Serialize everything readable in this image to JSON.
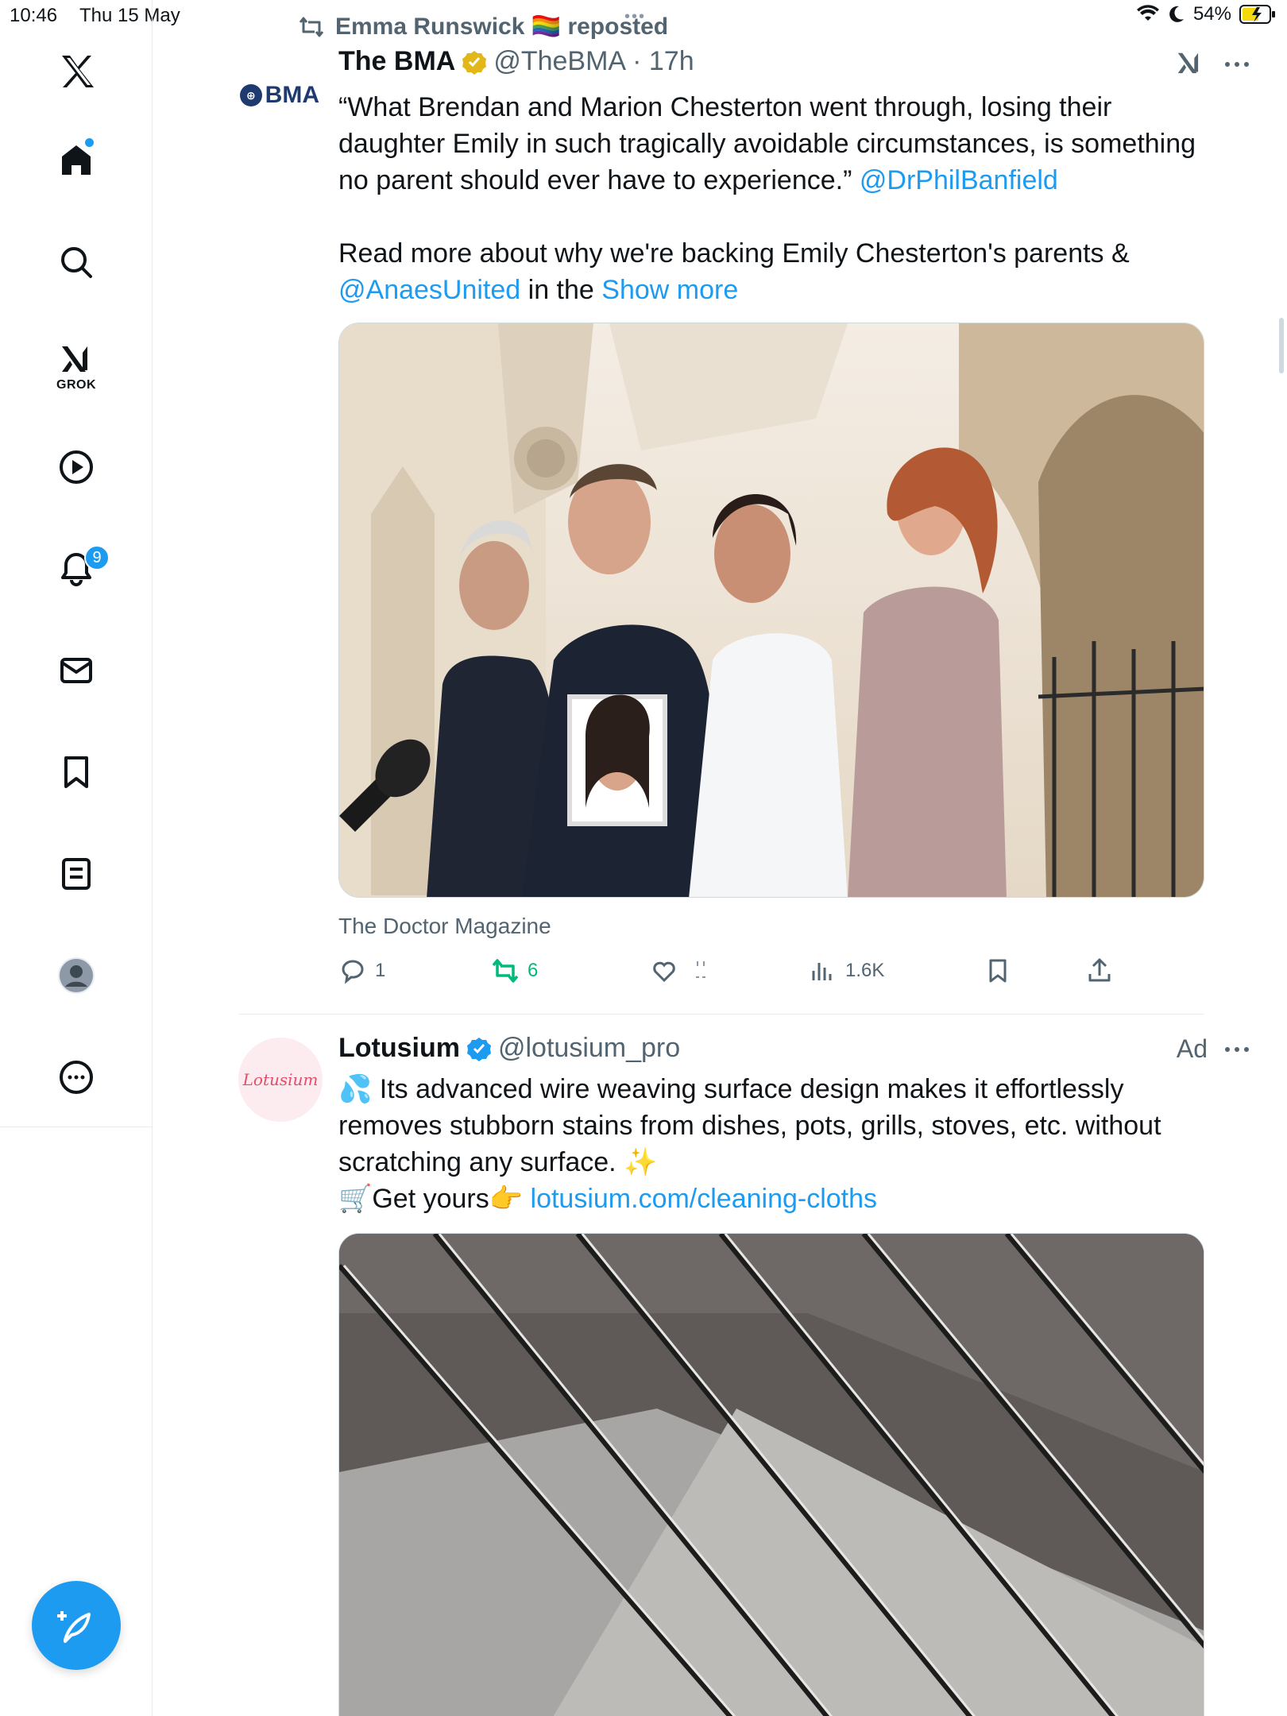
{
  "status_bar": {
    "time": "10:46",
    "date": "Thu 15 May",
    "battery": "54%"
  },
  "sidebar": {
    "items": [
      {
        "name": "x-logo",
        "label": ""
      },
      {
        "name": "home",
        "label": ""
      },
      {
        "name": "search",
        "label": ""
      },
      {
        "name": "grok",
        "label": "GROK"
      },
      {
        "name": "videos",
        "label": ""
      },
      {
        "name": "notifications",
        "label": "",
        "badge": "9"
      },
      {
        "name": "messages",
        "label": ""
      },
      {
        "name": "bookmarks",
        "label": ""
      },
      {
        "name": "lists",
        "label": ""
      },
      {
        "name": "profile",
        "label": ""
      },
      {
        "name": "more",
        "label": ""
      }
    ],
    "grok_label": "GROK",
    "notification_count": "9"
  },
  "tweet1": {
    "repost_by": "Emma Runswick 🏳️‍🌈 reposted",
    "avatar_text": "BMA",
    "display_name": "The BMA",
    "handle": "@TheBMA",
    "time": "· 17h",
    "body_part1": "“What Brendan and Marion Chesterton went through, losing their daughter Emily in such tragically avoidable circumstances, is something no parent should ever have to experience.” ",
    "mention1": "@DrPhilBanfield",
    "body_part2": "Read more about why we're backing Emily Chesterton's parents & ",
    "mention2": "@AnaesUnited",
    "body_part3": " in the ",
    "show_more": "Show more",
    "media_source": "The Doctor Magazine",
    "replies": "1",
    "reposts": "6",
    "views": "1.6K",
    "repost_color": "#00ba7c"
  },
  "tweet2": {
    "avatar_text": "Lotusium",
    "display_name": "Lotusium",
    "handle": "@lotusium_pro",
    "ad_label": "Ad",
    "body_line1": "💦 Its advanced wire weaving surface design makes it effortlessly removes stubborn stains from dishes, pots, grills, stoves, etc. without scratching any surface. ✨",
    "body_line2_prefix": "🛒Get yours👉 ",
    "link": "lotusium.com/cleaning-cloths"
  },
  "colors": {
    "accent": "#1d9bf0",
    "text_secondary": "#536471",
    "verified_gold": "#e2b719",
    "verified_blue": "#1d9bf0"
  }
}
